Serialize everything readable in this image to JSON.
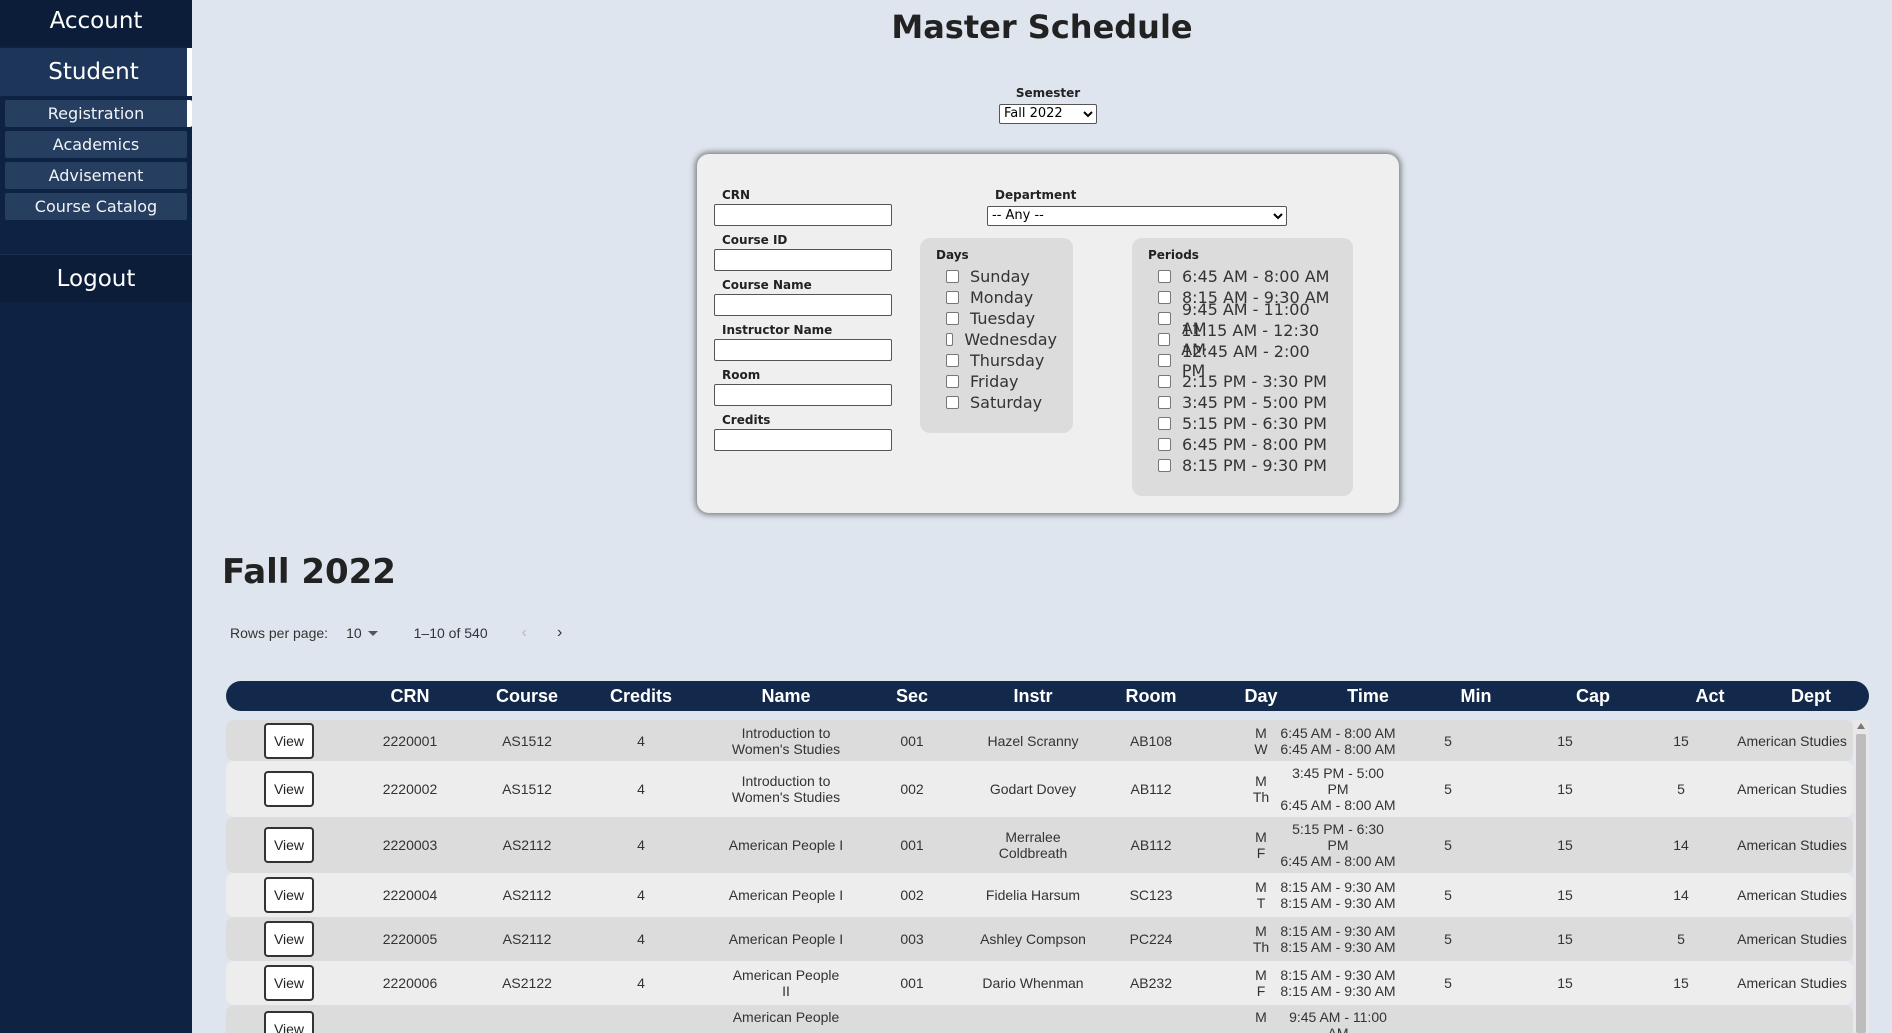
{
  "sidebar": {
    "account": "Account",
    "student": "Student",
    "items": [
      "Registration",
      "Academics",
      "Advisement",
      "Course Catalog"
    ],
    "logout": "Logout"
  },
  "title": "Master Schedule",
  "semester": {
    "label": "Semester",
    "value": "Fall 2022"
  },
  "filters": {
    "crn_label": "CRN",
    "course_id_label": "Course ID",
    "course_name_label": "Course Name",
    "instructor_label": "Instructor Name",
    "room_label": "Room",
    "credits_label": "Credits",
    "department_label": "Department",
    "department_value": "-- Any --",
    "days_label": "Days",
    "days": [
      "Sunday",
      "Monday",
      "Tuesday",
      "Wednesday",
      "Thursday",
      "Friday",
      "Saturday"
    ],
    "periods_label": "Periods",
    "periods": [
      "6:45 AM - 8:00 AM",
      "8:15 AM - 9:30 AM",
      "9:45 AM - 11:00 AM",
      "11:15 AM - 12:30 AM",
      "12:45 AM - 2:00 PM",
      "2:15 PM - 3:30 PM",
      "3:45 PM - 5:00 PM",
      "5:15 PM - 6:30 PM",
      "6:45 PM - 8:00 PM",
      "8:15 PM - 9:30 PM"
    ]
  },
  "section_title": "Fall 2022",
  "pager": {
    "rows_label": "Rows per page:",
    "rows_value": "10",
    "range": "1–10 of 540",
    "prev": "‹",
    "next": "›"
  },
  "table": {
    "headers": [
      "CRN",
      "Course",
      "Credits",
      "Name",
      "Sec",
      "Instr",
      "Room",
      "Day",
      "Time",
      "Min",
      "Cap",
      "Act",
      "Dept"
    ],
    "view_label": "View",
    "rows": [
      {
        "crn": "2220001",
        "course": "AS1512",
        "credits": "4",
        "name_1": "Introduction to",
        "name_2": "Women's Studies",
        "sec": "001",
        "instr_1": "Hazel Scranny",
        "instr_2": "",
        "room": "AB108",
        "day_1": "M",
        "day_2": "W",
        "time_1": "6:45 AM - 8:00 AM",
        "time_2": "6:45 AM - 8:00 AM",
        "time_3": "",
        "min": "5",
        "cap": "15",
        "act": "15",
        "dept": "American Studies"
      },
      {
        "crn": "2220002",
        "course": "AS1512",
        "credits": "4",
        "name_1": "Introduction to",
        "name_2": "Women's Studies",
        "sec": "002",
        "instr_1": "Godart Dovey",
        "instr_2": "",
        "room": "AB112",
        "day_1": "M",
        "day_2": "Th",
        "time_1": "3:45 PM - 5:00",
        "time_2": "PM",
        "time_3": "6:45 AM - 8:00 AM",
        "min": "5",
        "cap": "15",
        "act": "5",
        "dept": "American Studies"
      },
      {
        "crn": "2220003",
        "course": "AS2112",
        "credits": "4",
        "name_1": "American People I",
        "name_2": "",
        "sec": "001",
        "instr_1": "Merralee",
        "instr_2": "Coldbreath",
        "room": "AB112",
        "day_1": "M",
        "day_2": "F",
        "time_1": "5:15 PM - 6:30",
        "time_2": "PM",
        "time_3": "6:45 AM - 8:00 AM",
        "min": "5",
        "cap": "15",
        "act": "14",
        "dept": "American Studies"
      },
      {
        "crn": "2220004",
        "course": "AS2112",
        "credits": "4",
        "name_1": "American People I",
        "name_2": "",
        "sec": "002",
        "instr_1": "Fidelia Harsum",
        "instr_2": "",
        "room": "SC123",
        "day_1": "M",
        "day_2": "T",
        "time_1": "8:15 AM - 9:30 AM",
        "time_2": "8:15 AM - 9:30 AM",
        "time_3": "",
        "min": "5",
        "cap": "15",
        "act": "14",
        "dept": "American Studies"
      },
      {
        "crn": "2220005",
        "course": "AS2112",
        "credits": "4",
        "name_1": "American People I",
        "name_2": "",
        "sec": "003",
        "instr_1": "Ashley Compson",
        "instr_2": "",
        "room": "PC224",
        "day_1": "M",
        "day_2": "Th",
        "time_1": "8:15 AM - 9:30 AM",
        "time_2": "8:15 AM - 9:30 AM",
        "time_3": "",
        "min": "5",
        "cap": "15",
        "act": "5",
        "dept": "American Studies"
      },
      {
        "crn": "2220006",
        "course": "AS2122",
        "credits": "4",
        "name_1": "American People",
        "name_2": "II",
        "sec": "001",
        "instr_1": "Dario Whenman",
        "instr_2": "",
        "room": "AB232",
        "day_1": "M",
        "day_2": "F",
        "time_1": "8:15 AM - 9:30 AM",
        "time_2": "8:15 AM - 9:30 AM",
        "time_3": "",
        "min": "5",
        "cap": "15",
        "act": "15",
        "dept": "American Studies"
      },
      {
        "crn": "",
        "course": "",
        "credits": "",
        "name_1": "American People",
        "name_2": "",
        "sec": "",
        "instr_1": "",
        "instr_2": "",
        "room": "",
        "day_1": "M",
        "day_2": "",
        "time_1": "9:45 AM - 11:00",
        "time_2": "AM",
        "time_3": "",
        "min": "",
        "cap": "",
        "act": "",
        "dept": ""
      }
    ]
  }
}
